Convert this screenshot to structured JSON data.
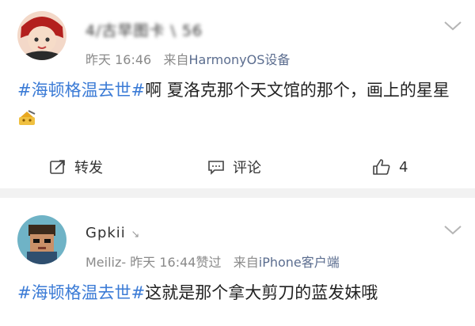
{
  "posts": [
    {
      "username": "4/古早图卡 \\ 56",
      "time": "昨天 16:46",
      "source_prefix": "来自",
      "source": "HarmonyOS设备",
      "hashtag": "#海顿格温去世#",
      "text": "啊 夏洛克那个天文馆的那个，画上的星星",
      "actions": {
        "repost": "转发",
        "comment": "评论",
        "like_count": "4"
      },
      "avatar_icon": "cartoon-character-avatar"
    },
    {
      "username": "Gpkii",
      "username_badge": "↘",
      "prefix": "Meiliz-",
      "time": "昨天 16:44",
      "liked_label": "赞过",
      "source_prefix": "来自",
      "source": "iPhone客户端",
      "hashtag": "#海顿格温去世#",
      "text": "这就是那个拿大剪刀的蓝发妹哦",
      "avatar_icon": "pixel-character-avatar"
    }
  ],
  "colors": {
    "link": "#3b7bd6",
    "meta": "#8a8a8a",
    "source": "#5b6d8f",
    "divider": "#f2f2f2"
  }
}
